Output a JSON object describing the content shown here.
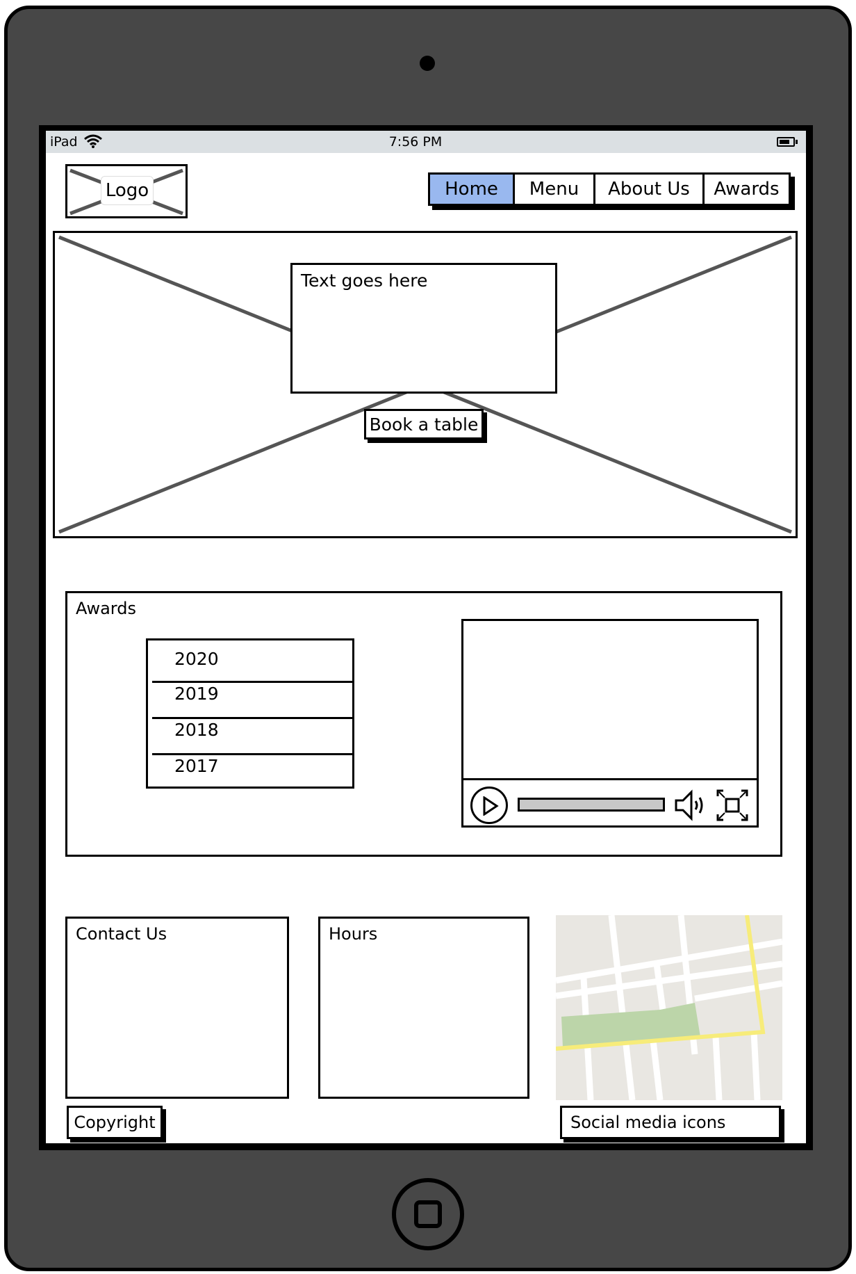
{
  "status_bar": {
    "device": "iPad",
    "time": "7:56 PM",
    "wifi_icon": "wifi-icon",
    "battery_icon": "battery-icon"
  },
  "header": {
    "logo": "Logo",
    "nav": [
      {
        "label": "Home",
        "active": true
      },
      {
        "label": "Menu",
        "active": false
      },
      {
        "label": "About Us",
        "active": false
      },
      {
        "label": "Awards",
        "active": false
      }
    ]
  },
  "hero": {
    "text": "Text goes here",
    "button": "Book a table"
  },
  "awards": {
    "title": "Awards",
    "years": [
      "2020",
      "2019",
      "2018",
      "2017"
    ],
    "video_controls": [
      "play-icon",
      "volume-icon",
      "fullscreen-icon"
    ]
  },
  "footer": {
    "contact": "Contact Us",
    "hours": "Hours",
    "copyright": "Copyright",
    "social": "Social media icons",
    "map_icon": "map-image"
  },
  "colors": {
    "active_tab": "#99b8ef",
    "device": "#474747",
    "statusbar": "#dbe0e3",
    "map_park": "#bcd5a9",
    "map_road": "#f7ec7a"
  }
}
